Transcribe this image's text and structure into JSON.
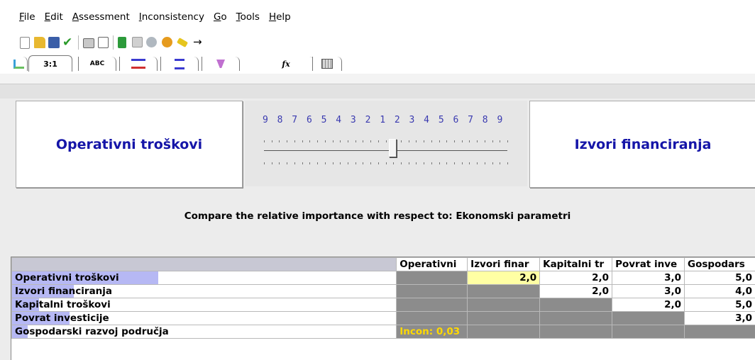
{
  "menu": [
    "File",
    "Edit",
    "Assessment",
    "Inconsistency",
    "Go",
    "Tools",
    "Help"
  ],
  "toolbar_icons": [
    "new-file-icon",
    "open-folder-icon",
    "save-disk-icon",
    "check-icon",
    "print-icon",
    "print-preview-icon",
    "calculator-icon",
    "chart-icon",
    "globe-icon",
    "refresh-icon",
    "wand-icon",
    "arrow-icon"
  ],
  "tabs": [
    {
      "name": "tree-view",
      "label": ""
    },
    {
      "name": "numeric",
      "label": "3:1"
    },
    {
      "name": "verbal",
      "label": "ABC"
    },
    {
      "name": "graphic-bar",
      "label": ""
    },
    {
      "name": "questionnaire",
      "label": ""
    },
    {
      "name": "matrix-view",
      "label": ""
    },
    {
      "name": "formula",
      "label": "fx"
    },
    {
      "name": "grid",
      "label": ""
    }
  ],
  "compare": {
    "left": "Operativni troškovi",
    "right": "Izvori financiranja",
    "scale": "9 8 7 6 5 4 3 2 1 2 3 4 5 6 7 8 9",
    "slider_value": 2,
    "slider_side": "right",
    "prompt": "Compare the relative importance with respect to: Ekonomski parametri"
  },
  "matrix": {
    "columns": [
      "Operativni",
      "Izvori finar",
      "Kapitalni tr",
      "Povrat inve",
      "Gospodars"
    ],
    "rows": [
      {
        "label": "Operativni troškovi",
        "highlight": 0.38,
        "cells": [
          "",
          "2,0",
          "2,0",
          "3,0",
          "5,0"
        ]
      },
      {
        "label": "Izvori financiranja",
        "highlight": 0.16,
        "cells": [
          "",
          "",
          "2,0",
          "3,0",
          "4,0"
        ]
      },
      {
        "label": "Kapitalni troškovi",
        "highlight": 0.07,
        "cells": [
          "",
          "",
          "",
          "2,0",
          "5,0"
        ]
      },
      {
        "label": "Povrat investicije",
        "highlight": 0.15,
        "cells": [
          "",
          "",
          "",
          "",
          "3,0"
        ]
      },
      {
        "label": "Gospodarski razvoj područja",
        "highlight": 0.04,
        "cells": [
          "Incon: 0,03",
          "",
          "",
          "",
          ""
        ]
      }
    ]
  }
}
